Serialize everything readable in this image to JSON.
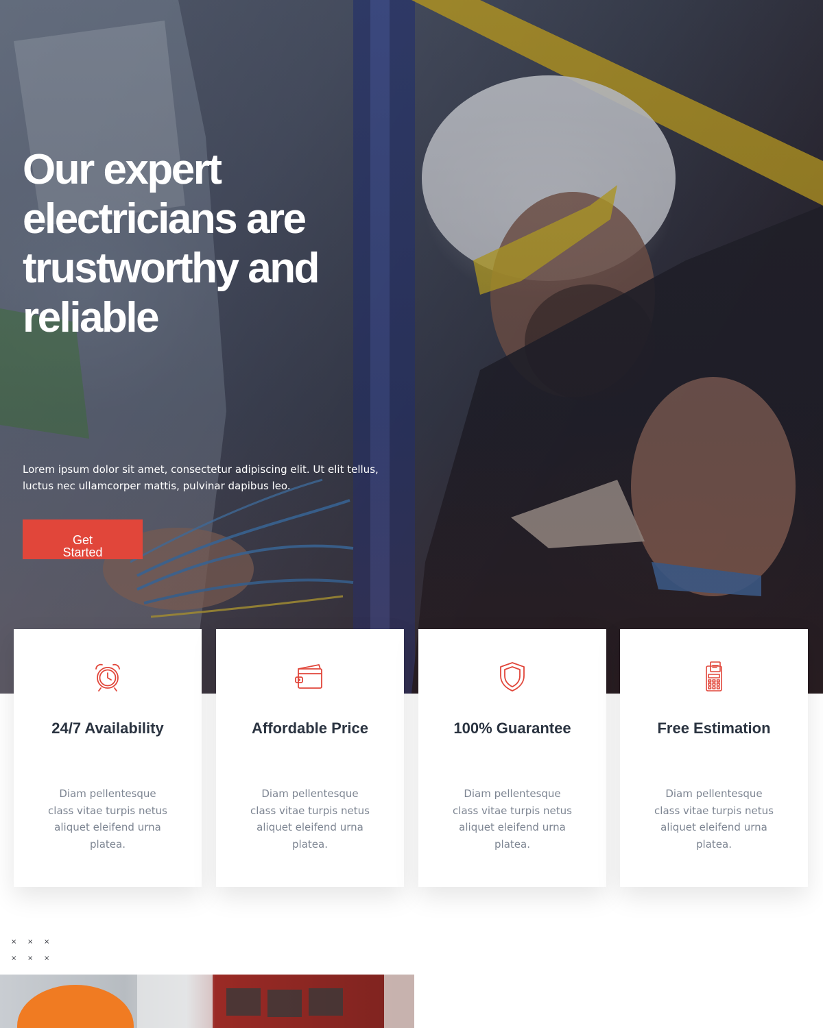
{
  "hero": {
    "title": "Our expert electricians are trustworthy and reliable",
    "text": "Lorem ipsum dolor sit amet, consectetur adipiscing elit. Ut elit tellus, luctus nec ullamcorper mattis, pulvinar dapibus leo.",
    "cta_label": "Get Started"
  },
  "colors": {
    "accent": "#e1463a",
    "heading": "#2a3340",
    "body_text": "#7d8592"
  },
  "features": [
    {
      "icon": "alarm-clock-icon",
      "title": "24/7 Availability",
      "text": "Diam pellentesque class vitae turpis netus aliquet eleifend urna platea."
    },
    {
      "icon": "wallet-icon",
      "title": "Affordable Price",
      "text": "Diam pellentesque class vitae turpis netus aliquet eleifend urna platea."
    },
    {
      "icon": "shield-icon",
      "title": "100% Guarantee",
      "text": "Diam pellentesque class vitae turpis netus aliquet eleifend urna platea."
    },
    {
      "icon": "calculator-receipt-icon",
      "title": "Free Estimation",
      "text": "Diam pellentesque class vitae turpis netus aliquet eleifend urna platea."
    }
  ]
}
